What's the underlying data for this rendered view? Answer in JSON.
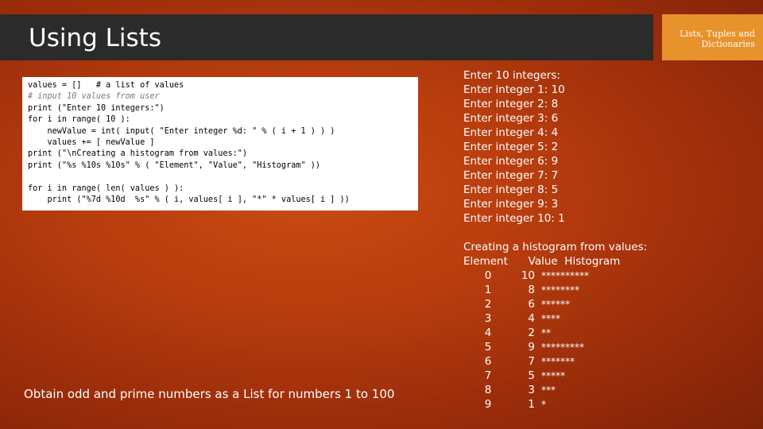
{
  "slide": {
    "title": "Using Lists",
    "tag": "Lists, Tuples and\nDictionaries",
    "task": "Obtain odd and prime numbers as a List for numbers 1 to 100"
  },
  "code_lines": [
    "values = []   # a list of values",
    "# input 10 values from user",
    "print (\"Enter 10 integers:\")",
    "for i in range( 10 ):",
    "    newValue = int( input( \"Enter integer %d: \" % ( i + 1 ) ) )",
    "    values += [ newValue ]",
    "print (\"\\nCreating a histogram from values:\")",
    "print (\"%s %10s %10s\" % ( \"Element\", \"Value\", \"Histogram\" ))",
    "",
    "for i in range( len( values ) ):",
    "    print (\"%7d %10d  %s\" % ( i, values[ i ], \"*\" * values[ i ] ))"
  ],
  "output": {
    "input_lines": [
      "Enter 10 integers:",
      "Enter integer 1: 10",
      "Enter integer 2: 8",
      "Enter integer 3: 6",
      "Enter integer 4: 4",
      "Enter integer 5: 2",
      "Enter integer 6: 9",
      "Enter integer 7: 7",
      "Enter integer 8: 5",
      "Enter integer 9: 3",
      "Enter integer 10: 1"
    ],
    "histogram_title": "Creating a histogram from values:",
    "histogram_header": "Element      Value  Histogram",
    "histogram_rows": [
      {
        "element": "0",
        "value": "10",
        "bar": "**********"
      },
      {
        "element": "1",
        "value": "8",
        "bar": "********"
      },
      {
        "element": "2",
        "value": "6",
        "bar": "******"
      },
      {
        "element": "3",
        "value": "4",
        "bar": "****"
      },
      {
        "element": "4",
        "value": "2",
        "bar": "**"
      },
      {
        "element": "5",
        "value": "9",
        "bar": "*********"
      },
      {
        "element": "6",
        "value": "7",
        "bar": "*******"
      },
      {
        "element": "7",
        "value": "5",
        "bar": "*****"
      },
      {
        "element": "8",
        "value": "3",
        "bar": "***"
      },
      {
        "element": "9",
        "value": "1",
        "bar": "*"
      }
    ]
  }
}
